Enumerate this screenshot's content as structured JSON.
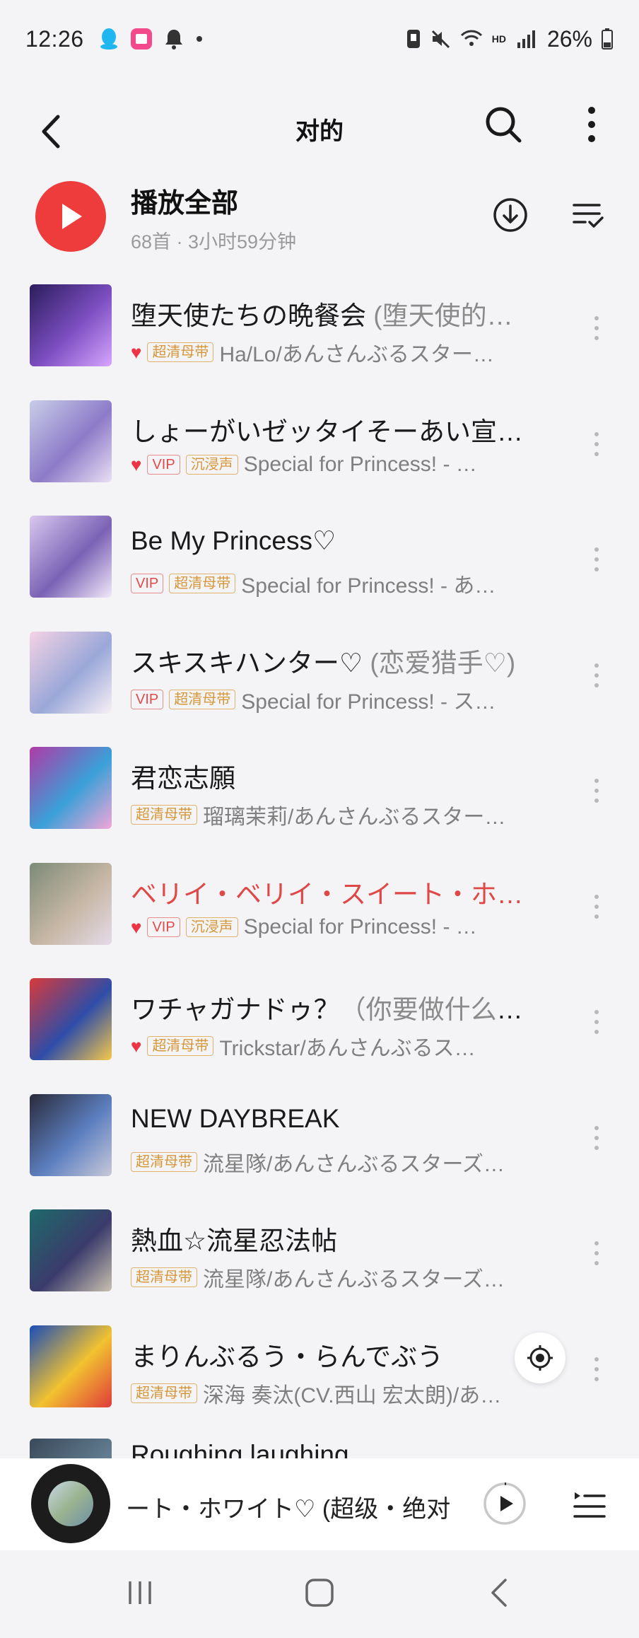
{
  "status_bar": {
    "time": "12:26",
    "battery": "26%",
    "network": "HD"
  },
  "header": {
    "title": "对的",
    "back_icon": "chevron-left-icon",
    "search_icon": "search-icon",
    "more_icon": "more-vertical-icon"
  },
  "play_all": {
    "label": "播放全部",
    "summary": "68首 · 3小时59分钟"
  },
  "songs": [
    {
      "title": "堕天使たちの晩餐会",
      "subtitle": " (堕天使的…",
      "liked": true,
      "tags": [
        "超清母带"
      ],
      "artist": "Ha/Lo/あんさんぶるスター…",
      "playing": false,
      "cover": [
        "#2b1d5c",
        "#7d4fc2",
        "#d7a6ff"
      ]
    },
    {
      "title": "しょーがいゼッタイそーあい宣…",
      "subtitle": "",
      "liked": true,
      "tags": [
        "VIP",
        "沉浸声"
      ],
      "artist": "Special for Princess! - …",
      "playing": false,
      "cover": [
        "#c9cde8",
        "#8c7ac8",
        "#e9e0f4"
      ]
    },
    {
      "title": "Be My Princess♡",
      "subtitle": "",
      "liked": false,
      "tags": [
        "VIP",
        "超清母带"
      ],
      "artist": "Special for Princess! - あ…",
      "playing": false,
      "cover": [
        "#d9c8ef",
        "#7a62b5",
        "#f1e9fa"
      ]
    },
    {
      "title": "スキスキハンター♡",
      "subtitle": " (恋爱猎手♡)",
      "liked": false,
      "tags": [
        "VIP",
        "超清母带"
      ],
      "artist": "Special for Princess! - ス…",
      "playing": false,
      "cover": [
        "#f4d3e4",
        "#9aa7d8",
        "#f8f0f6"
      ]
    },
    {
      "title": "君恋志願",
      "subtitle": "",
      "liked": false,
      "tags": [
        "超清母带"
      ],
      "artist": "瑠璃茉莉/あんさんぶるスター…",
      "playing": false,
      "cover": [
        "#b03aa6",
        "#3aa0d8",
        "#f3a6d8"
      ]
    },
    {
      "title": "ベリイ・ベリイ・スイート・ホ…",
      "subtitle": "",
      "liked": true,
      "tags": [
        "VIP",
        "沉浸声"
      ],
      "artist": "Special for Princess! - …",
      "playing": true,
      "cover": [
        "#7e8a78",
        "#c6b6a4",
        "#e4dbe8"
      ]
    },
    {
      "title": "ワチャガナドゥ？",
      "subtitle": "（你要做什么？）",
      "liked": true,
      "tags": [
        "超清母带"
      ],
      "artist": "Trickstar/あんさんぶるス…",
      "playing": false,
      "cover": [
        "#d83a3a",
        "#2e4da8",
        "#f6c84a"
      ]
    },
    {
      "title": "NEW DAYBREAK",
      "subtitle": "",
      "liked": false,
      "tags": [
        "超清母带"
      ],
      "artist": "流星隊/あんさんぶるスターズ…",
      "playing": false,
      "cover": [
        "#2a2a3a",
        "#5c7fc0",
        "#c8c8d8"
      ]
    },
    {
      "title": "熱血☆流星忍法帖",
      "subtitle": "",
      "liked": false,
      "tags": [
        "超清母带"
      ],
      "artist": "流星隊/あんさんぶるスターズ…",
      "playing": false,
      "cover": [
        "#1e6a6a",
        "#3b3b6b",
        "#c9c1b0"
      ]
    },
    {
      "title": "まりんぶるう・らんでぶう",
      "subtitle": "",
      "liked": false,
      "tags": [
        "超清母带"
      ],
      "artist": "深海 奏汰(CV.西山 宏太朗)/あ…",
      "playing": false,
      "cover": [
        "#1a4db8",
        "#f2c230",
        "#e03a3a"
      ]
    }
  ],
  "peek_song": {
    "title": "Roughing laughing"
  },
  "mini_player": {
    "title": "ート・ホワイト♡ (超级・绝对"
  },
  "colors": {
    "accent": "#ee3b3b",
    "tag_gold": "#d6963a",
    "tag_vip": "#e34a4a"
  }
}
